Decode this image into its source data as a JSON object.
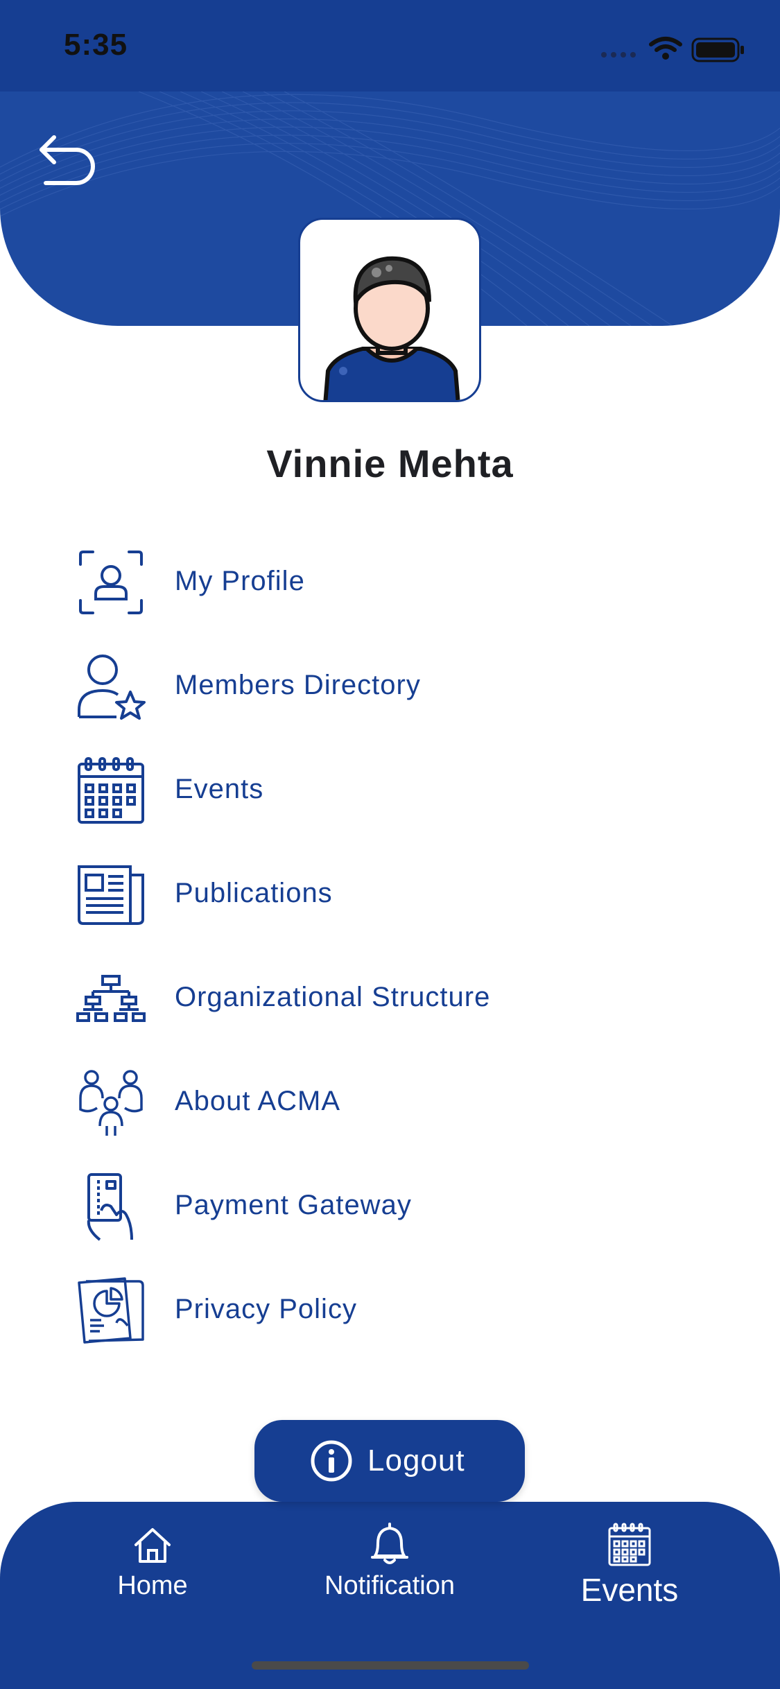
{
  "status_bar": {
    "time": "5:35"
  },
  "profile": {
    "name": "Vinnie Mehta"
  },
  "menu": {
    "items": [
      {
        "label": "My Profile",
        "icon": "profile-scan-icon"
      },
      {
        "label": "Members Directory",
        "icon": "member-star-icon"
      },
      {
        "label": "Events",
        "icon": "calendar-icon"
      },
      {
        "label": "Publications",
        "icon": "newspaper-icon"
      },
      {
        "label": "Organizational Structure",
        "icon": "org-chart-icon"
      },
      {
        "label": "About ACMA",
        "icon": "team-icon"
      },
      {
        "label": "Payment Gateway",
        "icon": "card-hand-icon"
      },
      {
        "label": "Privacy Policy",
        "icon": "document-chart-icon"
      }
    ]
  },
  "logout": {
    "label": "Logout"
  },
  "bottom_nav": {
    "home": "Home",
    "notification": "Notification",
    "events": "Events"
  },
  "colors": {
    "primary": "#163e92",
    "header": "#1e4aa0",
    "text_dark": "#1f2024"
  }
}
